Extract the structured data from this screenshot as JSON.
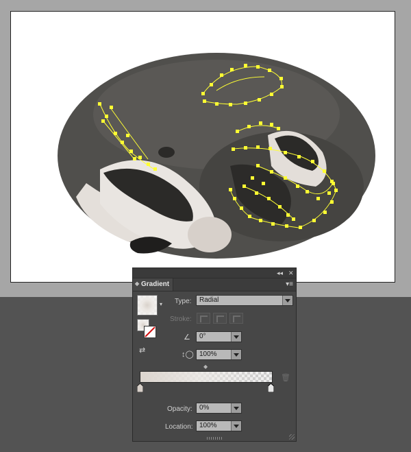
{
  "panel": {
    "title": "Gradient",
    "collapse_glyph": "◂◂",
    "close_glyph": "✕",
    "menu_glyph": "▾≡",
    "type_label": "Type:",
    "type_value": "Radial",
    "stroke_label": "Stroke:",
    "angle_value": "0°",
    "aspect_value": "100%",
    "opacity_label": "Opacity:",
    "opacity_value": "0%",
    "location_label": "Location:",
    "location_value": "100%"
  },
  "colors": {
    "anchor_highlight": "#ffff33",
    "fur_dark": "#4f4e4b",
    "fur_light": "#d8d2cc"
  }
}
